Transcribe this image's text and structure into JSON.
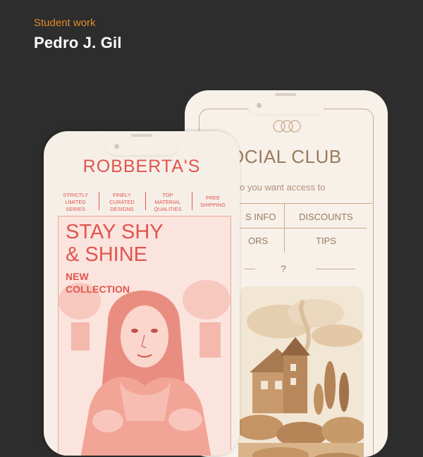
{
  "header": {
    "kicker": "Student work",
    "author": "Pedro J. Gil"
  },
  "colors": {
    "background": "#2d2d2d",
    "accent_orange": "#e08a2c",
    "brand_red": "#e0554f",
    "club_brown": "#9b7a5c"
  },
  "social_phone": {
    "logo_icon": "interlocked-rings-icon",
    "title": "OCIAL CLUB",
    "access_prompt": "o you want access to",
    "options": [
      "S INFO",
      "DISCOUNTS",
      "ORS",
      "TIPS"
    ],
    "separator": "?",
    "image_icon": "english-manor-garden-illustration"
  },
  "brand_phone": {
    "brand": "ROBBERTA'S",
    "features": [
      "STRICTLY LIMITED SERIES",
      "FINELY CURATED DESIGNS",
      "TOP MATERIAL QUALITIES",
      "FREE SHIPPING"
    ],
    "hero": {
      "headline_line1": "STAY SHY",
      "headline_line2": "& SHINE",
      "sub_line1": "NEW",
      "sub_line2": "COLLECTION",
      "image_icon": "young-woman-portrait-illustration"
    }
  }
}
